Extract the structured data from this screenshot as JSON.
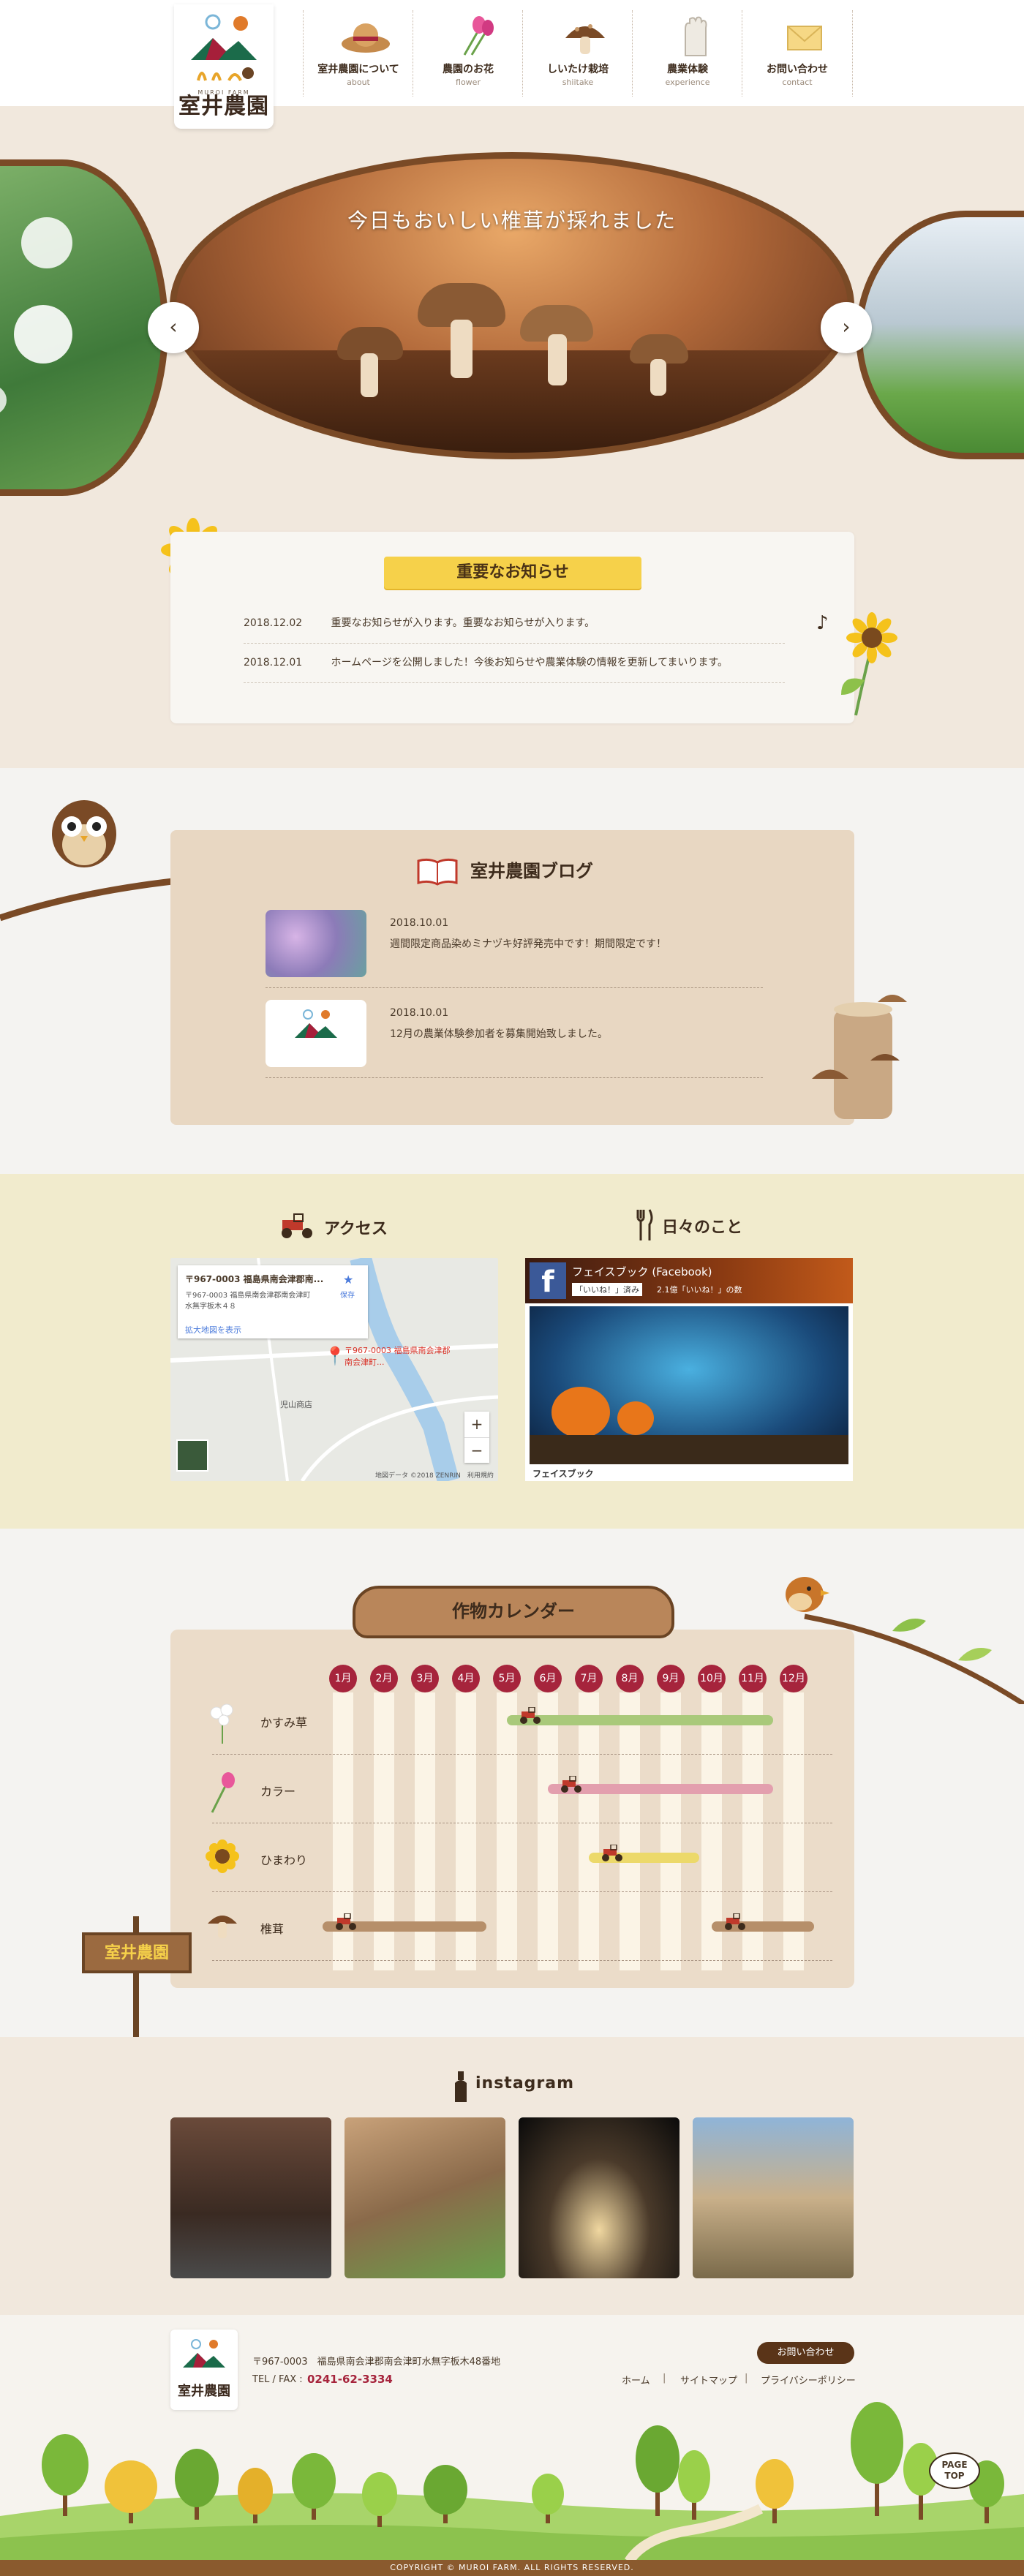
{
  "brand": {
    "name": "室井農園",
    "sub": "MUROI FARM"
  },
  "nav": [
    {
      "jp": "室井農園について",
      "en": "about",
      "icon": "hat-icon"
    },
    {
      "jp": "農園のお花",
      "en": "flower",
      "icon": "flower-icon"
    },
    {
      "jp": "しいたけ栽培",
      "en": "shiitake",
      "icon": "mushroom-icon"
    },
    {
      "jp": "農業体験",
      "en": "experience",
      "icon": "glove-icon"
    },
    {
      "jp": "お問い合わせ",
      "en": "contact",
      "icon": "mail-icon"
    }
  ],
  "hero": {
    "caption": "今日もおいしい椎茸が採れました",
    "prev": "‹",
    "next": "›"
  },
  "news": {
    "title": "重要なお知らせ",
    "items": [
      {
        "date": "2018.12.02",
        "text": "重要なお知らせが入ります。重要なお知らせが入ります。"
      },
      {
        "date": "2018.12.01",
        "text": "ホームページを公開しました！今後お知らせや農業体験の情報を更新してまいります。"
      }
    ]
  },
  "blog": {
    "title": "室井農園ブログ",
    "items": [
      {
        "date": "2018.10.01",
        "text": "週間限定商品染めミナヅキ好評発売中です！期間限定です！"
      },
      {
        "date": "2018.10.01",
        "text": "12月の農業体験参加者を募集開始致しました。"
      }
    ]
  },
  "access": {
    "title": "アクセス",
    "map": {
      "address_title": "〒967-0003 福島県南会津郡南...",
      "address_body": "〒967-0003 福島県南会津郡南会津町水無字板木４８",
      "save": "保存",
      "enlarge": "拡大地図を表示",
      "pin_label": "〒967-0003 福島県南会津郡南会津町...",
      "shop": "児山商店",
      "footer": "地図データ ©2018 ZENRIN　利用規約",
      "zoom_in": "+",
      "zoom_out": "−"
    }
  },
  "daily": {
    "title": "日々のこと",
    "fb_name": "フェイスブック (Facebook)",
    "fb_like": "「いいね！」済み",
    "fb_count": "2.1億「いいね！」の数",
    "fb_bottom": "フェイスブック"
  },
  "calendar": {
    "title": "作物カレンダー",
    "months": [
      "1月",
      "2月",
      "3月",
      "4月",
      "5月",
      "6月",
      "7月",
      "8月",
      "9月",
      "10月",
      "11月",
      "12月"
    ],
    "crops": [
      {
        "name": "かすみ草",
        "color": "#a9c97a",
        "periods": [
          [
            5,
            11.5
          ]
        ]
      },
      {
        "name": "カラー",
        "color": "#e39fae",
        "periods": [
          [
            6,
            11.5
          ]
        ]
      },
      {
        "name": "ひまわり",
        "color": "#ecd96a",
        "periods": [
          [
            7,
            9.7
          ]
        ]
      },
      {
        "name": "椎茸",
        "color": "#b68f6a",
        "periods": [
          [
            0.5,
            4.5
          ],
          [
            10,
            12.5
          ]
        ]
      }
    ],
    "signpost": "室井農園"
  },
  "instagram": {
    "title": "instagram"
  },
  "footer": {
    "address": "〒967-0003　福島県南会津郡南会津町水無字板木48番地",
    "tel_label": "TEL / FAX :",
    "tel": "0241-62-3334",
    "links": [
      "ホーム",
      "サイトマップ",
      "プライバシーポリシー"
    ],
    "separators": [
      "|",
      "|"
    ],
    "contact": "お問い合わせ",
    "pagetop_1": "PAGE",
    "pagetop_2": "TOP",
    "copyright": "COPYRIGHT © MUROI FARM. ALL RIGHTS RESERVED."
  }
}
